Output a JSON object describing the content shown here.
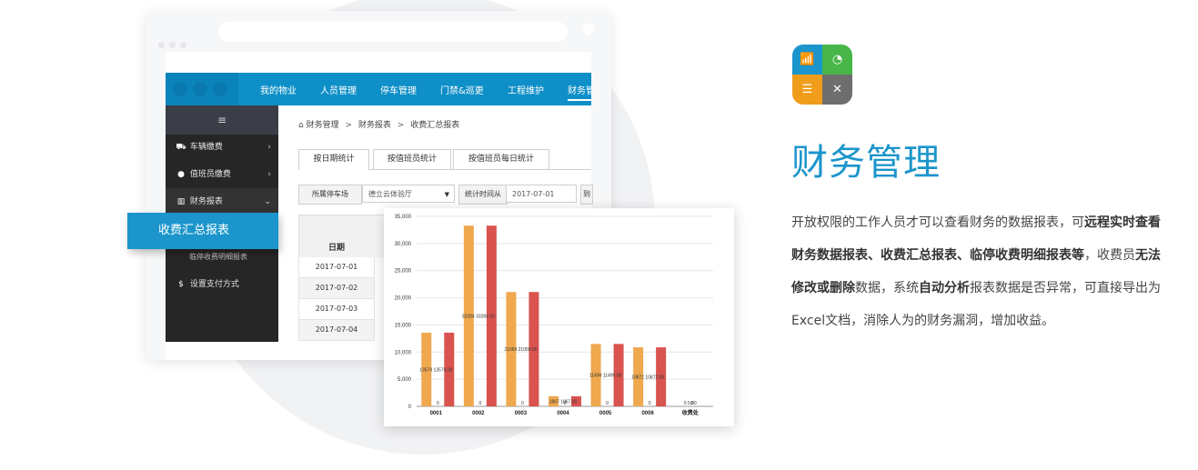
{
  "mockup": {
    "topnav": {
      "items": [
        "我的物业",
        "人员管理",
        "停车管理",
        "门禁&巡更",
        "工程维护",
        "财务管"
      ]
    },
    "sidebar": {
      "toggle_icon": "≡",
      "items": [
        {
          "label": "车辆缴费",
          "icon": "car-icon",
          "arrow": "›"
        },
        {
          "label": "值班员缴费",
          "icon": "user-circle-icon",
          "arrow": "›"
        },
        {
          "label": "财务报表",
          "icon": "bar-chart-icon",
          "arrow": "⌄"
        }
      ],
      "subitems": [
        "临停收费明细报表"
      ],
      "extra_item": {
        "label": "设置支付方式",
        "icon": "dollar-icon"
      }
    },
    "flyout": {
      "label": "收费汇总报表"
    },
    "breadcrumb": {
      "home_icon": "home-icon",
      "items": [
        "财务管理",
        "财务报表",
        "收费汇总报表"
      ],
      "separator": ">"
    },
    "tabs": [
      "按日期统计",
      "按值班员统计",
      "按值班员每日统计"
    ],
    "filter": {
      "lot_label": "所属停车场",
      "lot_value": "德立云体验厅",
      "time_label": "统计时间从",
      "time_value": "2017-07-01",
      "to_label": "到"
    },
    "table": {
      "date_header": "日期",
      "dates": [
        "2017-07-01",
        "2017-07-02",
        "2017-07-03",
        "2017-07-04"
      ]
    }
  },
  "chart_data": {
    "type": "bar",
    "categories": [
      "0001",
      "0002",
      "0003",
      "0004",
      "0005",
      "0006",
      "收费处"
    ],
    "series": [
      {
        "values": [
          13579,
          33284,
          21059,
          1867,
          11499,
          10872,
          0
        ],
        "color": "#efa84e"
      },
      {
        "values": [
          0,
          0,
          0,
          0,
          0,
          0,
          0
        ],
        "color": "#efa84e"
      },
      {
        "values": [
          13579,
          33284,
          21059,
          1867,
          11499,
          10872,
          0
        ],
        "color": "#d9534f"
      }
    ],
    "data_labels": [
      "13579 13579.00",
      "33284 33284.00",
      "21059 21059.00",
      "1867 1867.00",
      "11499 11499.00",
      "10872 10872.00",
      "0 0.00"
    ],
    "zero_label": "0",
    "ylim": [
      0,
      35000
    ],
    "yticks": [
      0,
      5000,
      10000,
      15000,
      20000,
      25000,
      30000,
      35000
    ],
    "ytick_labels": [
      "0",
      "5,000",
      "10,000",
      "15,000",
      "20,000",
      "25,000",
      "30,000",
      "35,000"
    ],
    "grid": true,
    "title": "",
    "xlabel": "",
    "ylabel": ""
  },
  "feature": {
    "title": "财务管理",
    "desc": [
      {
        "text": "开放权限的工作人员才可以查看财务的数据报表，可",
        "bold": false
      },
      {
        "text": "远程实时查看财务数据报表、收费汇总报表、临停收费明细报表等",
        "bold": true
      },
      {
        "text": "，收费员",
        "bold": false
      },
      {
        "text": "无法修改或删除",
        "bold": true
      },
      {
        "text": "数据，系统",
        "bold": false
      },
      {
        "text": "自动分析",
        "bold": true
      },
      {
        "text": "报表数据是否异常，可直接导出为Excel文档，消除人为的财务漏洞，增加收益。",
        "bold": false
      }
    ]
  },
  "app_icon": {
    "quadrants": [
      {
        "icon": "line-chart-icon",
        "glyph": "📶",
        "color": "#1b95cb"
      },
      {
        "icon": "pie-chart-icon",
        "glyph": "◔",
        "color": "#48b649"
      },
      {
        "icon": "bar-list-icon",
        "glyph": "☰",
        "color": "#f19d1c"
      },
      {
        "icon": "scatter-icon",
        "glyph": "✕",
        "color": "#6e6e6e"
      }
    ]
  }
}
